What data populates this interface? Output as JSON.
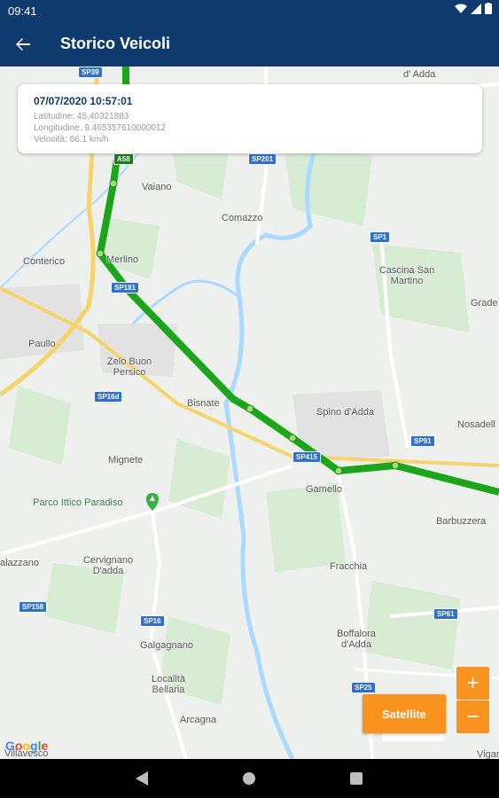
{
  "status_bar": {
    "time": "09:41"
  },
  "app_bar": {
    "title": "Storico Veicoli"
  },
  "info_card": {
    "date": "07/07/2020 10:57:01",
    "latitude": "Latitudine: 45.40321883",
    "longitude": "Longitudine: 9.465357610000012",
    "speed": "Velocità: 66.1 km/h"
  },
  "map": {
    "places": {
      "adda": "d' Adda",
      "vaiano": "Vaiano",
      "comazzo": "Comazzo",
      "conterico": "Conterico",
      "merlino": "Merlino",
      "cascina": "Cascina San\nMartino",
      "grade": "Grade",
      "paullo": "Paullo",
      "zelo": "Zelo Buon\nPersico",
      "bisnate": "Bisnate",
      "spino": "Spino d'Adda",
      "nosadello": "Nosadell",
      "mignete": "Mignete",
      "gamello": "Gamello",
      "barbuzzera": "Barbuzzera",
      "parco": "Parco Ittico Paradiso",
      "cervignano": "Cervignano\nD'adda",
      "fracchia": "Fracchia",
      "alazzano": "alazzano",
      "galgagnano": "Galgagnano",
      "boffalora": "Boffalora\nd'Adda",
      "localita": "Località\nBellaria",
      "arcagna": "Arcagna",
      "vigano": "Vigan",
      "villavesco": "Villavesco"
    },
    "roads": {
      "a58": "A58",
      "sp201": "SP201",
      "sp1": "SP1",
      "sp181": "SP181",
      "sp16d": "SP16d",
      "sp415": "SP415",
      "sp91": "SP91",
      "sp158": "SP158",
      "sp16": "SP16",
      "sp61": "SP61",
      "sp25": "SP25",
      "sp_top": "SP39"
    },
    "colors": {
      "route": "#1aa51a",
      "water": "#aadaff",
      "shield": "#2f6fd0"
    }
  },
  "controls": {
    "zoom_in": "+",
    "zoom_out": "−",
    "satellite": "Satellite",
    "google": "Google"
  },
  "colors": {
    "app_bar": "#0f3a6e",
    "accent": "#f7931e"
  }
}
